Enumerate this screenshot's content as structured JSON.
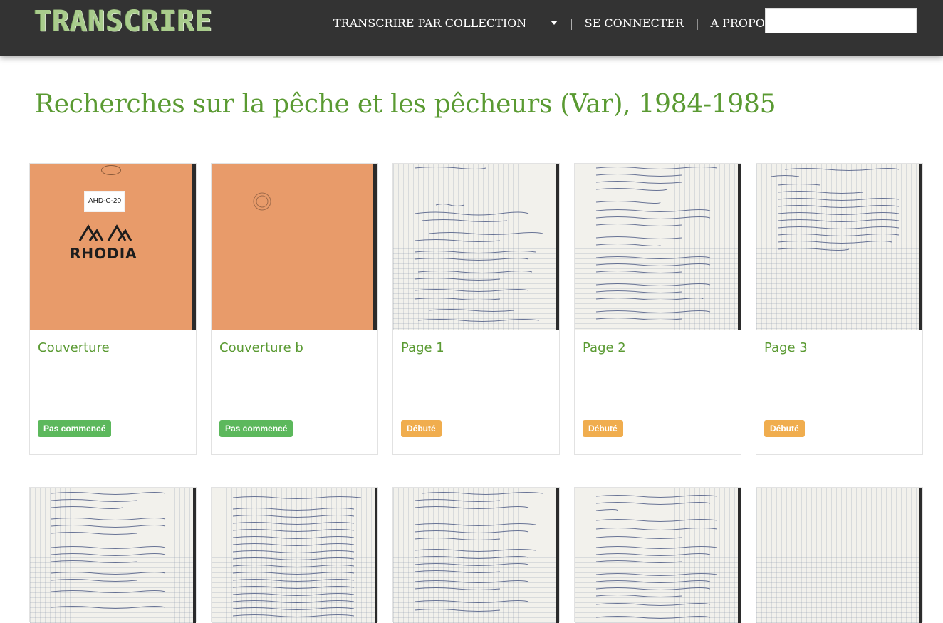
{
  "header": {
    "logo": "TRANSCRIRE",
    "nav": {
      "collections": "TRANSCRIRE PAR COLLECTION",
      "login": "SE CONNECTER",
      "about": "A PROPOS",
      "separator": "|"
    },
    "search": {
      "placeholder": ""
    }
  },
  "page": {
    "title": "Recherches sur la pêche et les pêcheurs (Var), 1984-1985"
  },
  "cover_texts": {
    "label": "AHD-C-20",
    "brand": "RHODIA"
  },
  "cards": [
    {
      "title": "Couverture",
      "status": "Pas commencé",
      "status_color": "#5cb85c"
    },
    {
      "title": "Couverture b",
      "status": "Pas commencé",
      "status_color": "#5cb85c"
    },
    {
      "title": "Page 1",
      "status": "Débuté",
      "status_color": "#f0ad4e"
    },
    {
      "title": "Page 2",
      "status": "Débuté",
      "status_color": "#f0ad4e"
    },
    {
      "title": "Page 3",
      "status": "Débuté",
      "status_color": "#f0ad4e"
    }
  ],
  "colors": {
    "accent": "#5a9a32",
    "header_bg": "#333333"
  }
}
